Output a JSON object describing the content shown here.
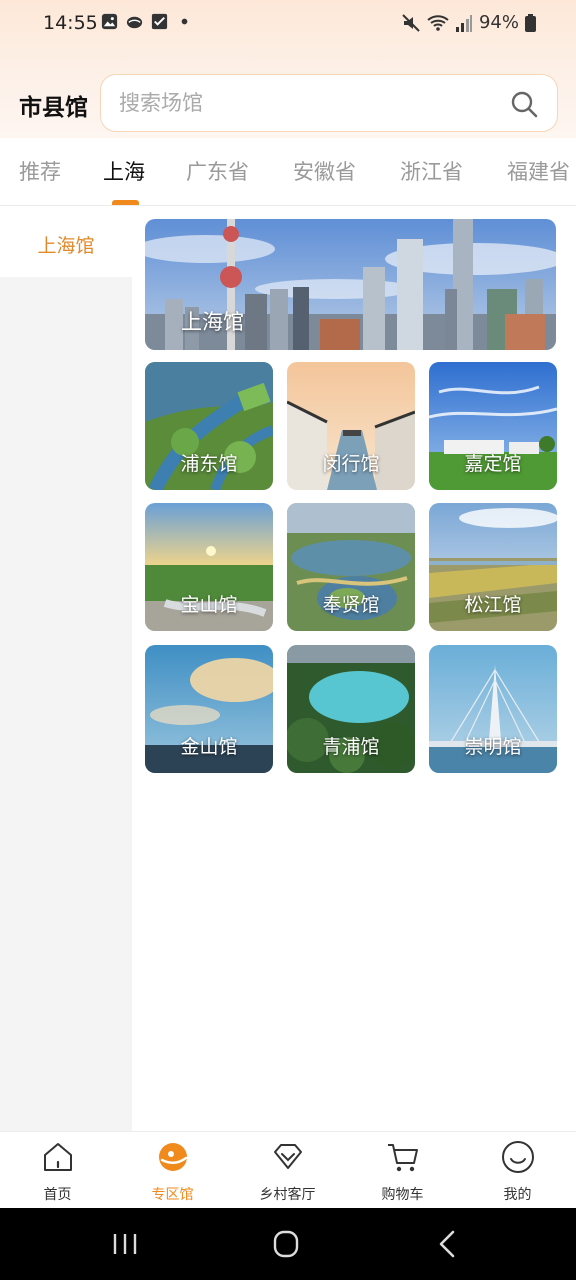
{
  "status": {
    "time": "14:55",
    "battery": "94%"
  },
  "header": {
    "title": "市县馆",
    "search_placeholder": "搜索场馆"
  },
  "tabs": [
    "推荐",
    "上海",
    "广东省",
    "安徽省",
    "浙江省",
    "福建省"
  ],
  "active_tab": "上海",
  "sidebar": {
    "items": [
      {
        "label": "上海馆",
        "active": true
      }
    ]
  },
  "featured": {
    "label": "上海馆"
  },
  "venues": [
    {
      "label": "浦东馆"
    },
    {
      "label": "闵行馆"
    },
    {
      "label": "嘉定馆"
    },
    {
      "label": "宝山馆"
    },
    {
      "label": "奉贤馆"
    },
    {
      "label": "松江馆"
    },
    {
      "label": "金山馆"
    },
    {
      "label": "青浦馆"
    },
    {
      "label": "崇明馆"
    }
  ],
  "bottom_nav": [
    {
      "label": "首页",
      "icon": "home-icon"
    },
    {
      "label": "专区馆",
      "icon": "zone-icon",
      "active": true
    },
    {
      "label": "乡村客厅",
      "icon": "diamond-icon"
    },
    {
      "label": "购物车",
      "icon": "cart-icon"
    },
    {
      "label": "我的",
      "icon": "smile-icon"
    }
  ],
  "colors": {
    "accent": "#f08a1c",
    "sidebar_active_text": "#e08a2b"
  }
}
